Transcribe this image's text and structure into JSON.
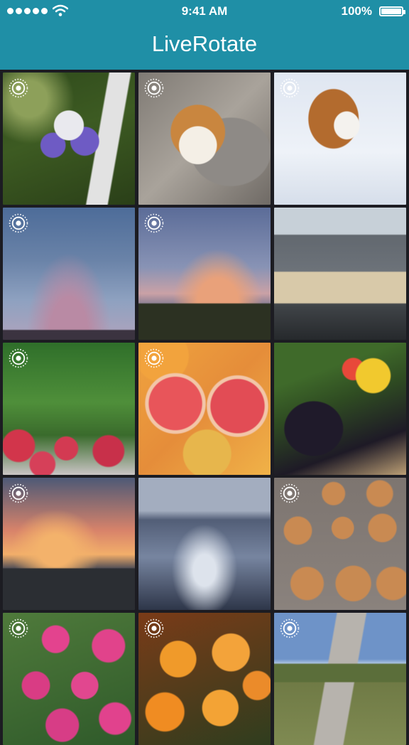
{
  "status_bar": {
    "time": "9:41 AM",
    "battery": "100%",
    "signal_icon": "signal-dots-icon",
    "wifi_icon": "wifi-icon",
    "battery_icon": "battery-icon"
  },
  "header": {
    "title": "LiveRotate",
    "background": "#1f8fa6"
  },
  "grid": {
    "badge_icon": "live-photo-icon",
    "photos": [
      {
        "subject": "columbine-flower"
      },
      {
        "subject": "corgi-on-blanket"
      },
      {
        "subject": "corgi-in-snow"
      },
      {
        "subject": "cloudy-sky"
      },
      {
        "subject": "bare-tree-sunset"
      },
      {
        "subject": "apple-store"
      },
      {
        "subject": "radishes"
      },
      {
        "subject": "grapefruits"
      },
      {
        "subject": "market-produce"
      },
      {
        "subject": "airplane-wing-sunset"
      },
      {
        "subject": "airplane-wing-clouds"
      },
      {
        "subject": "cookies-on-tray"
      },
      {
        "subject": "pink-mums"
      },
      {
        "subject": "orange-mums"
      },
      {
        "subject": "corgi-on-gravel-road"
      }
    ]
  }
}
